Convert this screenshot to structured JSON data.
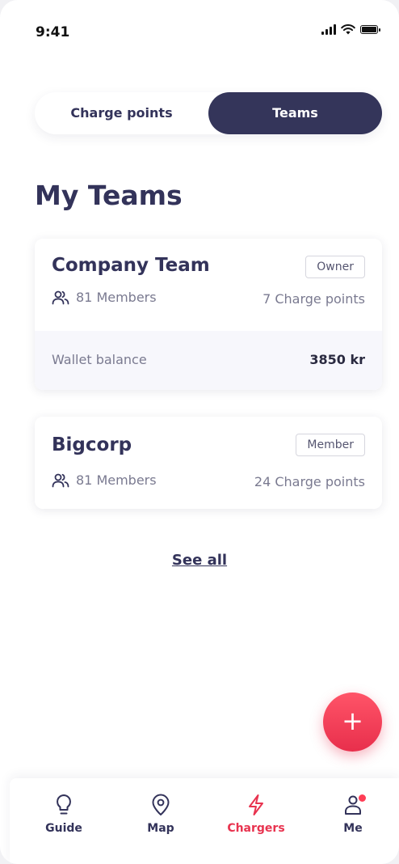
{
  "status_bar": {
    "time": "9:41"
  },
  "segmented": {
    "left_label": "Charge points",
    "right_label": "Teams",
    "selected": "Teams"
  },
  "page_title": "My Teams",
  "teams": [
    {
      "name": "Company Team",
      "role": "Owner",
      "members": "81 Members",
      "charge_points": "7 Charge points",
      "wallet_label": "Wallet balance",
      "wallet_value": "3850 kr"
    },
    {
      "name": "Bigcorp",
      "role": "Member",
      "members": "81 Members",
      "charge_points": "24 Charge points"
    }
  ],
  "see_all_label": "See all",
  "fab": {
    "icon": "plus-icon",
    "label": "+"
  },
  "bottom_nav": [
    {
      "label": "Guide",
      "icon": "lightbulb-icon"
    },
    {
      "label": "Map",
      "icon": "map-pin-icon"
    },
    {
      "label": "Chargers",
      "icon": "lightning-icon",
      "active": true
    },
    {
      "label": "Me",
      "icon": "user-icon",
      "notification": true
    }
  ],
  "colors": {
    "navy": "#34355a",
    "accent": "#e8334f",
    "background": "#ffffff"
  }
}
